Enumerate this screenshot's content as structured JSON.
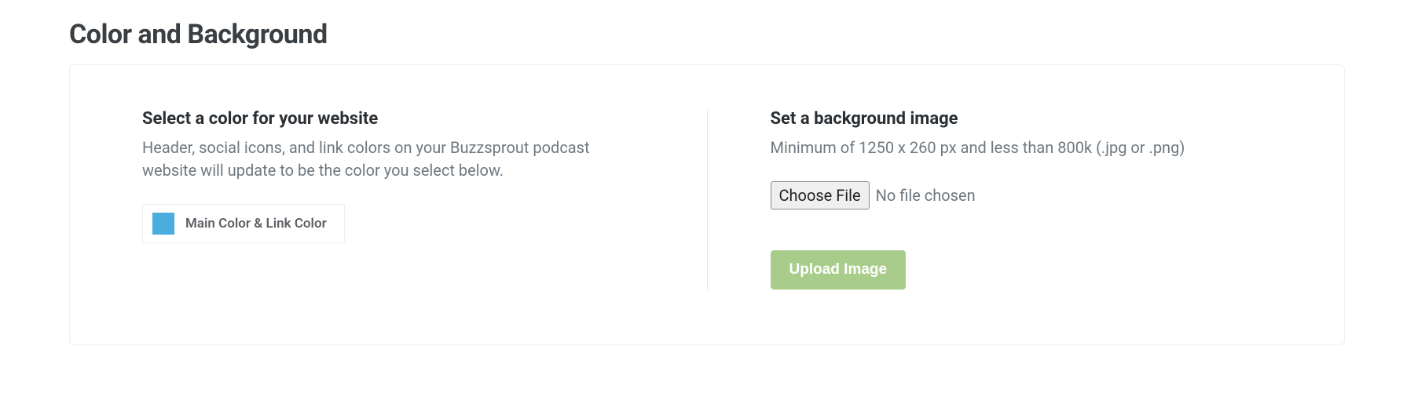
{
  "header": {
    "title": "Color and Background"
  },
  "left": {
    "title": "Select a color for your website",
    "description": "Header, social icons, and link colors on your Buzzsprout podcast website will update to be the color you select below.",
    "swatch_color": "#49aede",
    "color_label": "Main Color & Link Color"
  },
  "right": {
    "title": "Set a background image",
    "description": "Minimum of 1250 x 260 px and less than 800k (.jpg or .png)",
    "choose_file_label": "Choose File",
    "file_status": "No file chosen",
    "upload_label": "Upload Image"
  }
}
